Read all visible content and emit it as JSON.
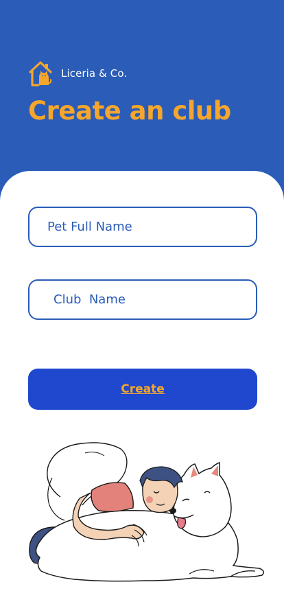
{
  "brand": {
    "name": "Liceria & Co.",
    "logo_icon": "house-cat-logo-icon"
  },
  "header": {
    "title": "Create an club"
  },
  "form": {
    "pet_full_name": {
      "value": "Pet Full Name"
    },
    "club_name": {
      "value": "Club  Name"
    },
    "create_label": "Create"
  },
  "illustration": {
    "icon": "boy-hugging-dog-illustration"
  },
  "colors": {
    "header_bg": "#2a5cb8",
    "accent": "#f5a62b",
    "button_bg": "#1f48cf",
    "field_border": "#2a5cb8"
  }
}
